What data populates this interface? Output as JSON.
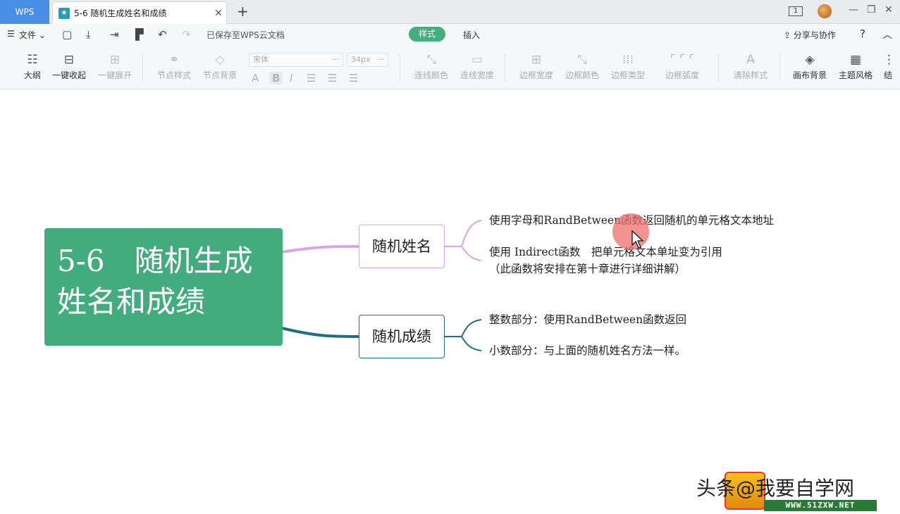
{
  "titlebar": {
    "app_tab": "WPS",
    "doc_tab_title": "5-6 随机生成姓名和成绩",
    "page_indicator": "1"
  },
  "menubar": {
    "file_label": "文件",
    "save_status": "已保存至WPS云文档",
    "tab_style": "样式",
    "tab_insert": "插入",
    "share_label": "分享与协作",
    "help_label": "?"
  },
  "toolbar": {
    "outline": "大纲",
    "collapse_all": "一键收起",
    "expand_all": "一键展开",
    "node_style": "节点样式",
    "node_bg": "节点背景",
    "font_placeholder": "宋体",
    "size_placeholder": "34px",
    "line_color": "连线颜色",
    "line_width": "连线宽度",
    "border_width": "边框宽度",
    "border_color": "边框颜色",
    "border_type": "边框类型",
    "border_radius": "边框弧度",
    "clear_style": "清除样式",
    "canvas_bg": "画布背景",
    "theme_style": "主题风格",
    "partial": "结"
  },
  "mindmap": {
    "root": "5-6　随机生成姓名和成绩",
    "root_line1": "5-6　随机生成",
    "root_line2": "姓名和成绩",
    "branch1": {
      "label": "随机姓名",
      "leaves": [
        "使用字母和RandBetween函数返回随机的单元格文本地址",
        "使用 Indirect函数　把单元格文本单址变为引用",
        "（此函数将安排在第十章进行详细讲解）"
      ]
    },
    "branch2": {
      "label": "随机成绩",
      "leaves": [
        "整数部分：使用RandBetween函数返回",
        "小数部分：与上面的随机姓名方法一样。"
      ]
    }
  },
  "watermark": {
    "text": "头条@我要自学网",
    "url": "WWW.51ZXW.NET"
  },
  "colors": {
    "accent_green": "#42ac7e",
    "branch1_line": "#d7a6e8",
    "branch2_line": "#1e6e85",
    "wps_blue": "#4a8fe7"
  }
}
